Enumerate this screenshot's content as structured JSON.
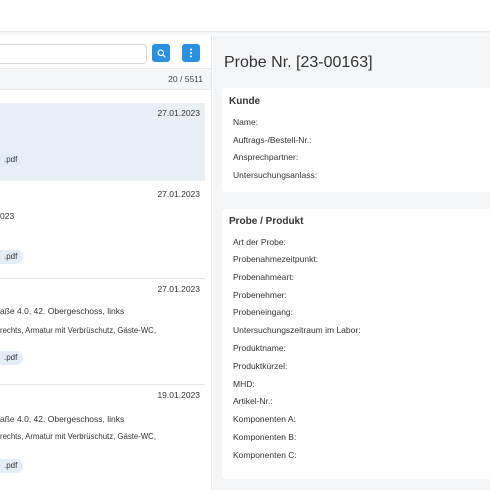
{
  "search": {
    "placeholder": ""
  },
  "list": {
    "count": "20 / 5511",
    "items": [
      {
        "date": "27.01.2023",
        "lines": [],
        "pill": ".pdf"
      },
      {
        "date": "27.01.2023",
        "lines": [
          "023"
        ],
        "pill": ".pdf"
      },
      {
        "date": "27.01.2023",
        "lines": [
          "aße 4.0, 42. Obergeschoss, links",
          "rechts, Armatur mit Verbrüschutz, Gäste-WC,"
        ],
        "pill": ".pdf"
      },
      {
        "date": "19.01.2023",
        "lines": [
          "aße 4.0, 42. Obergeschoss, links",
          "rechts, Armatur mit Verbrüschutz, Gäste-WC,"
        ],
        "pill": ".pdf"
      }
    ]
  },
  "detail": {
    "title": "Probe Nr. [23-00163]",
    "kunde": {
      "title": "Kunde",
      "fields": [
        "Name:",
        "Auftrags-/Bestell-Nr.:",
        "Ansprechpartner:",
        "Untersuchungsanlass:"
      ]
    },
    "probe": {
      "title": "Probe / Produkt",
      "fields": [
        "Art der Probe:",
        "Probenahmezeitpunkt:",
        "Probenahmeart:",
        "Probenehmer:",
        "Probeneingang:",
        "Untersuchungszeitraum im Labor:",
        "Produktname:",
        "Produktkürzel:",
        "MHD:",
        "Artikel-Nr.:",
        "Komponenten A:",
        "Komponenten B:",
        "Komponenten C:"
      ]
    }
  },
  "icons": {
    "search": "search-icon",
    "menu": "kebab-menu-icon"
  },
  "colors": {
    "accent": "#2b8fe0",
    "active_row": "#e9eff7",
    "pill": "#e3edf8"
  }
}
